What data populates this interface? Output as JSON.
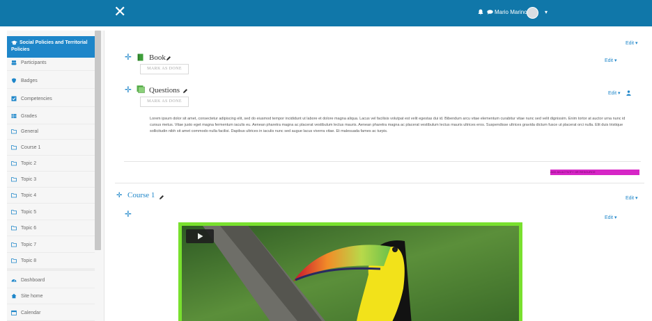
{
  "topbar": {
    "close_glyph": "✕",
    "user_name": "Mario Marino",
    "caret": "▾",
    "icons": [
      "bell-icon",
      "chat-icon"
    ],
    "color": "#1077a9"
  },
  "sidebar": {
    "active": {
      "label": "Social Policies and Territorial Policies",
      "icon": "graduation-cap-icon"
    },
    "items": [
      {
        "label": "Participants",
        "icon": "users-icon"
      },
      {
        "label": "Badges",
        "icon": "shield-icon"
      },
      {
        "label": "Competencies",
        "icon": "check-square-icon"
      },
      {
        "label": "Grades",
        "icon": "table-icon"
      },
      {
        "label": "General",
        "icon": "folder-icon"
      },
      {
        "label": "Course 1",
        "icon": "folder-icon"
      },
      {
        "label": "Topic 2",
        "icon": "folder-icon"
      },
      {
        "label": "Topic 3",
        "icon": "folder-icon"
      },
      {
        "label": "Topic 4",
        "icon": "folder-icon"
      },
      {
        "label": "Topic 5",
        "icon": "folder-icon"
      },
      {
        "label": "Topic 6",
        "icon": "folder-icon"
      },
      {
        "label": "Topic 7",
        "icon": "folder-icon"
      },
      {
        "label": "Topic 8",
        "icon": "folder-icon"
      }
    ],
    "bottom_items": [
      {
        "label": "Dashboard",
        "icon": "dashboard-icon"
      },
      {
        "label": "Site home",
        "icon": "home-icon"
      },
      {
        "label": "Calendar",
        "icon": "calendar-icon"
      }
    ]
  },
  "main": {
    "edit_label": "Edit ▾",
    "activities": [
      {
        "title": "Book",
        "button": "MARK AS DONE",
        "icon": "book-icon"
      },
      {
        "title": "Questions",
        "button": "MARK AS DONE",
        "icon": "questionnaire-icon"
      }
    ],
    "description": "Lorem ipsum dolor sit amet, consectetur adipiscing elit, sed do eiusmod tempor incididunt ut labore et dolore magna aliqua. Lacus vel facilisis volutpat est velit egestas dui id. Bibendum arcu vitae elementum curabitur vitae nunc sed velit dignissim. Enim tortor at auctor urna nunc id cursus metus. Vitae justo eget magna fermentum iaculis eu. Aenean pharetra magna ac placerat vestibulum lectus mauris. Aenean pharetra magna ac placerat vestibulum lectus mauris ultrices eros. Suspendisse ultrices gravida dictum fusce ut placerat orci nulla. Elit duis tristique sollicitudin nibh sit amet commodo nulla facilisi. Dapibus ultrices in iaculis nunc sed augue lacus viverra vitae. Et malesuada fames ac turpis.",
    "add_activity": "ADD AN ACTIVITY OR RESOURCE",
    "section": {
      "title": "Course 1"
    },
    "video_icon": "play-icon"
  }
}
